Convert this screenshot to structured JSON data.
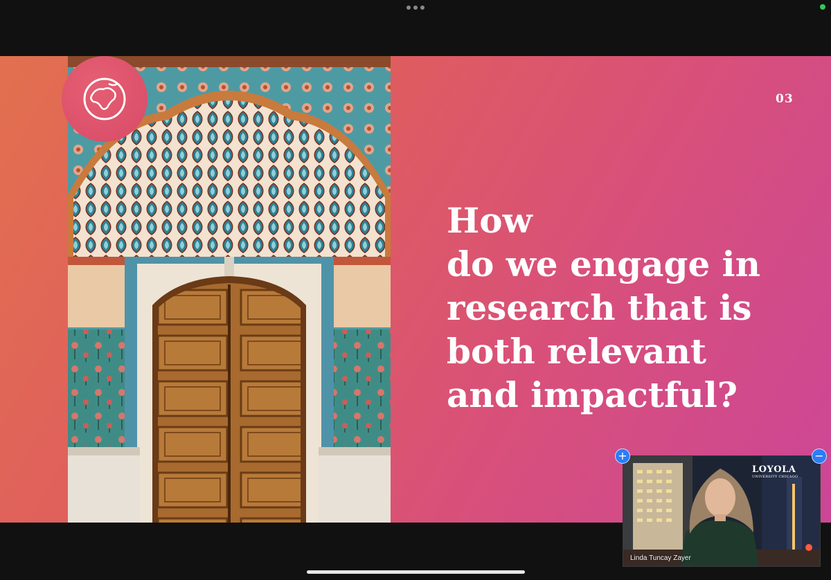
{
  "slide": {
    "number": "03",
    "question_lines": [
      "How",
      "do we engage in",
      "research that is",
      "both relevant",
      "and impactful?"
    ]
  },
  "video": {
    "participant_name": "Linda Tuncay Zayer",
    "background_logo_text": "LOYOLA",
    "background_logo_sub": "UNIVERSITY CHICAGO",
    "expand_button_label": "+",
    "collapse_button_label": "−"
  },
  "icons": {
    "top": "more-dots-icon",
    "status": "status-dot-icon",
    "logo": "globe-map-icon"
  }
}
